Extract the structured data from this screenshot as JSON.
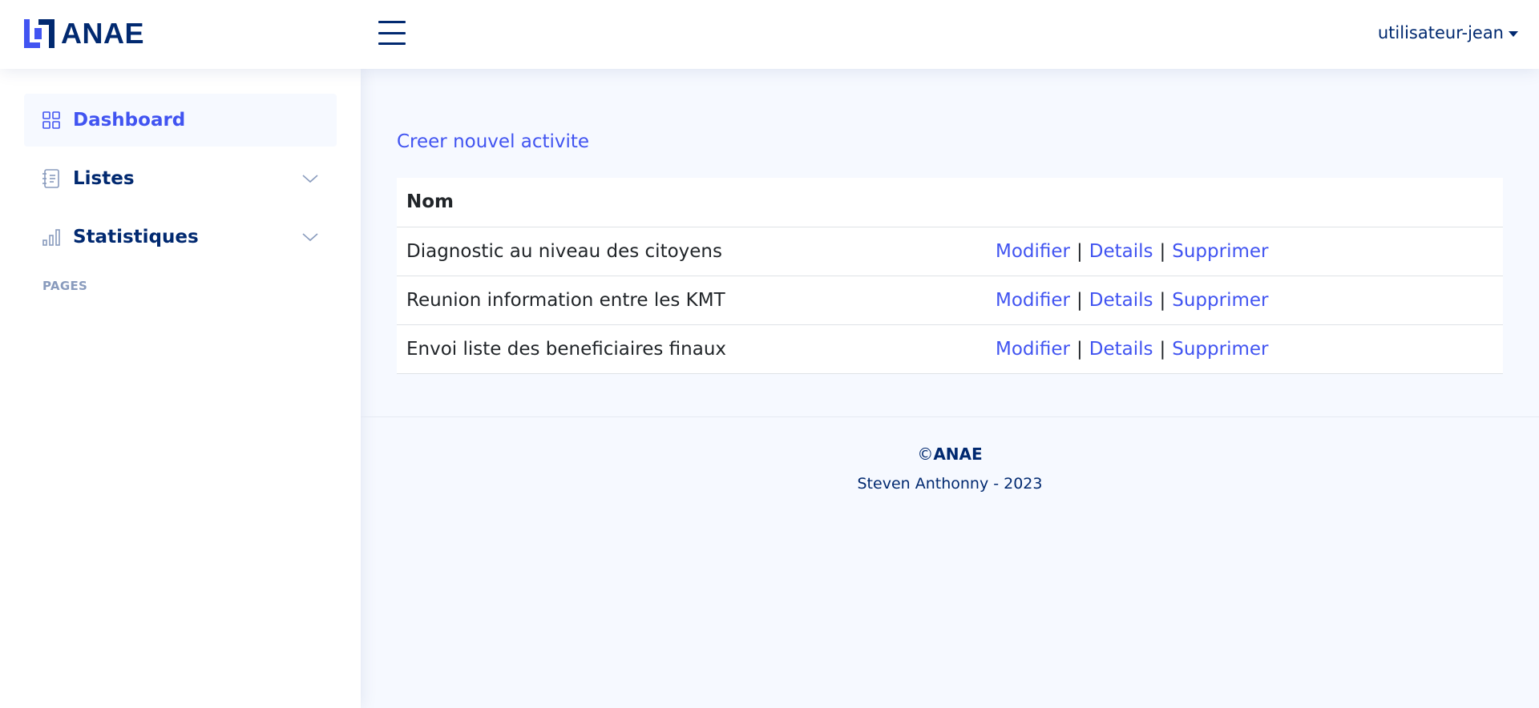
{
  "header": {
    "brand": "ANAE",
    "user": "utilisateur-jean"
  },
  "sidebar": {
    "items": [
      {
        "label": "Dashboard",
        "icon": "grid-icon",
        "active": true
      },
      {
        "label": "Listes",
        "icon": "journal-text-icon",
        "expandable": true
      },
      {
        "label": "Statistiques",
        "icon": "bar-chart-icon",
        "expandable": true
      }
    ],
    "heading": "PAGES"
  },
  "main": {
    "create_link": "Creer nouvel activite",
    "table": {
      "header": "Nom",
      "rows": [
        {
          "name": "Diagnostic au niveau des citoyens"
        },
        {
          "name": "Reunion information entre les KMT"
        },
        {
          "name": "Envoi liste des beneficiaires finaux"
        }
      ],
      "actions": {
        "edit": "Modifier",
        "details": "Details",
        "delete": "Supprimer",
        "separator": "|"
      }
    }
  },
  "footer": {
    "copyright_symbol": "©",
    "copyright_brand": "ANAE",
    "credits": "Steven Anthonny - 2023"
  },
  "colors": {
    "primary": "#4154f1",
    "navy": "#012970",
    "background": "#f6f9ff",
    "muted": "#899bbd"
  }
}
